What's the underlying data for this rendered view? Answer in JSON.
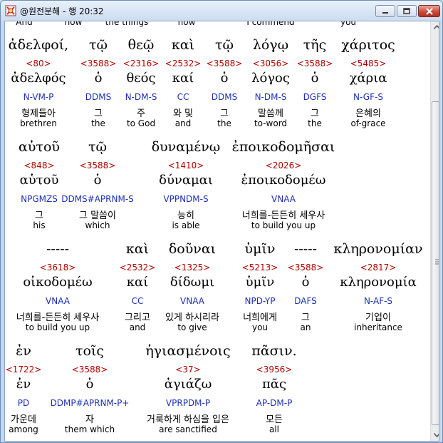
{
  "window": {
    "title": "@원전분해 - 행 20:32"
  },
  "top_cut": [
    "And",
    "now",
    "the things",
    "now",
    "I commend",
    "you"
  ],
  "blocks": [
    {
      "words": [
        {
          "greek": "ἀδελφοί,",
          "strong": "<80>",
          "lemma": "ἀδελφός",
          "morph": "N-VM-P",
          "korean": "형제들아",
          "english": "brethren"
        },
        {
          "greek": "τῷ",
          "strong": "<3588>",
          "lemma": "ὁ",
          "morph": "DDMS",
          "korean": "그",
          "english": "the"
        },
        {
          "greek": "θεῷ",
          "strong": "<2316>",
          "lemma": "θεός",
          "morph": "N-DM-S",
          "korean": "주",
          "english": "to God"
        },
        {
          "greek": "καὶ",
          "strong": "<2532>",
          "lemma": "καί",
          "morph": "CC",
          "korean": "와 및",
          "english": "and"
        },
        {
          "greek": "τῷ",
          "strong": "<3588>",
          "lemma": "ὁ",
          "morph": "DDMS",
          "korean": "그",
          "english": "the"
        },
        {
          "greek": "λόγῳ",
          "strong": "<3056>",
          "lemma": "λόγος",
          "morph": "N-DM-S",
          "korean": "말씀께",
          "english": "to-word"
        },
        {
          "greek": "τῆς",
          "strong": "<3588>",
          "lemma": "ὁ",
          "morph": "DGFS",
          "korean": "그",
          "english": "the"
        },
        {
          "greek": "χάριτος",
          "strong": "<5485>",
          "lemma": "χάρια",
          "morph": "N-GF-S",
          "korean": "은혜의",
          "english": "of-grace"
        }
      ]
    },
    {
      "words": [
        {
          "greek": "αὐτοῦ",
          "strong": "<848>",
          "lemma": "αὑτοῦ",
          "morph": "NPGMZS",
          "korean": "그",
          "english": "his"
        },
        {
          "greek": "τῷ",
          "strong": "<3588>",
          "lemma": "ὁ",
          "morph": "DDMS#APRNM-S",
          "korean": "그 말씀이",
          "english": "which"
        },
        {
          "greek": "δυναμένῳ",
          "strong": "<1410>",
          "lemma": "δύναμαι",
          "morph": "VPPNDM-S",
          "korean": "능히",
          "english": "is able"
        },
        {
          "greek": "ἐποικοδομῆσαι",
          "strong": "<2026>",
          "lemma": "ἐποικοδομέω",
          "morph": "VNAA",
          "korean": "너희를-든든히 세우사",
          "english": "to build you up"
        }
      ]
    },
    {
      "words": [
        {
          "greek": "-----",
          "strong": "<3618>",
          "lemma": "οἰκοδομέω",
          "morph": "VNAA",
          "korean": "너희를-든든히 세우사",
          "english": "to build you up"
        },
        {
          "greek": "καὶ",
          "strong": "<2532>",
          "lemma": "καί",
          "morph": "CC",
          "korean": "그리고",
          "english": "and"
        },
        {
          "greek": "δοῦναι",
          "strong": "<1325>",
          "lemma": "δίδωμι",
          "morph": "VNAA",
          "korean": "있게 하시리라",
          "english": "to give"
        },
        {
          "greek": "ὑμῖν",
          "strong": "<5213>",
          "lemma": "ὑμῖν",
          "morph": "NPD-YP",
          "korean": "너희에게",
          "english": "you"
        },
        {
          "greek": "-----",
          "strong": "<3588>",
          "lemma": "ὁ",
          "morph": "DAFS",
          "korean": "그",
          "english": "an"
        },
        {
          "greek": "κληρονομίαν",
          "strong": "<2817>",
          "lemma": "κληρονομία",
          "morph": "N-AF-S",
          "korean": "기업이",
          "english": "inheritance"
        }
      ]
    },
    {
      "words": [
        {
          "greek": "ἐν",
          "strong": "<1722>",
          "lemma": "ἐν",
          "morph": "PD",
          "korean": "가운데",
          "english": "among"
        },
        {
          "greek": "τοῖς",
          "strong": "<3588>",
          "lemma": "ὁ",
          "morph": "DDMP#APRNM-P+",
          "korean": "자",
          "english": "them which"
        },
        {
          "greek": "ἡγιασμένοις",
          "strong": "<37>",
          "lemma": "ἁγιάζω",
          "morph": "VPRPDM-P",
          "korean": "거룩하게 하심을 입은",
          "english": "are sanctified"
        },
        {
          "greek": "πᾶσιν.",
          "strong": "<3956>",
          "lemma": "πᾶς",
          "morph": "AP-DM-P",
          "korean": "모든",
          "english": "all"
        }
      ]
    }
  ]
}
